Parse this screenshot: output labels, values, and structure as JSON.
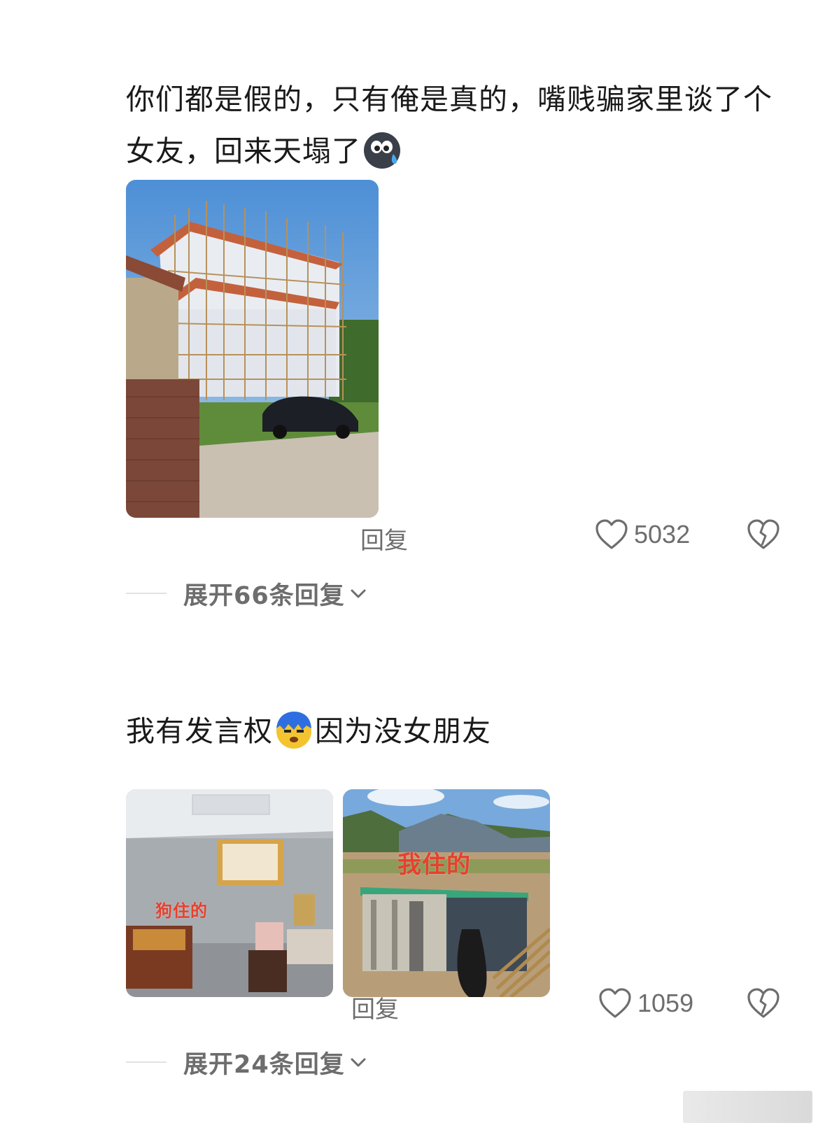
{
  "comments": [
    {
      "text_before_emoji": "你们都是假的，只有俺是真的，嘴贱骗家里谈了个女友，回来天塌了",
      "text_after_emoji": "",
      "emoji": "crying-face-emoji",
      "images": [
        {
          "description_icon": "house-photo"
        }
      ],
      "reply_label": "回复",
      "like_count": "5032",
      "expand_label": "展开66条回复"
    },
    {
      "text_before_emoji": "我有发言权",
      "text_after_emoji": "因为没女朋友",
      "emoji": "shocked-face-emoji",
      "images": [
        {
          "overlay_text": "狗住的"
        },
        {
          "overlay_text": "我住的"
        }
      ],
      "reply_label": "回复",
      "like_count": "1059",
      "expand_label": "展开24条回复"
    }
  ],
  "colors": {
    "text": "#1a1a1a",
    "secondary": "#6d6d6d",
    "overlay_red": "#e8402c"
  }
}
